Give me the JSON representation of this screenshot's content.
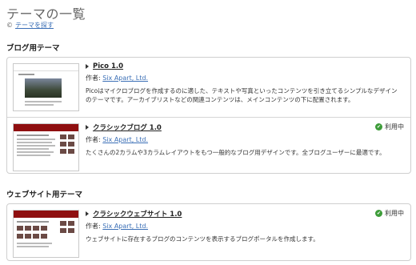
{
  "page": {
    "title": "テーマの一覧"
  },
  "find_themes": {
    "icon": "©",
    "label": "テーマを探す"
  },
  "sections": {
    "blog": {
      "title": "ブログ用テーマ"
    },
    "website": {
      "title": "ウェブサイト用テーマ"
    }
  },
  "author_prefix": "作者:",
  "themes": [
    {
      "name": "Pico 1.0",
      "author": "Six Apart, Ltd.",
      "description": "Picoはマイクロブログを作成するのに適した、テキストや写真といったコンテンツを引き立てるシンプルなデザインのテーマです。アーカイブリストなどの関連コンテンツは、メインコンテンツの下に配置されます。",
      "in_use": false
    },
    {
      "name": "クラシックブログ 1.0",
      "author": "Six Apart, Ltd.",
      "description": "たくさんの2カラムや3カラムレイアウトをもつ一般的なブログ用デザインです。全ブログユーザーに最適です。",
      "in_use": true,
      "status_label": "利用中"
    },
    {
      "name": "クラシックウェブサイト 1.0",
      "author": "Six Apart, Ltd.",
      "description": "ウェブサイトに存在するブログのコンテンツを表示するブログポータルを作成します。",
      "in_use": true,
      "status_label": "利用中"
    }
  ]
}
